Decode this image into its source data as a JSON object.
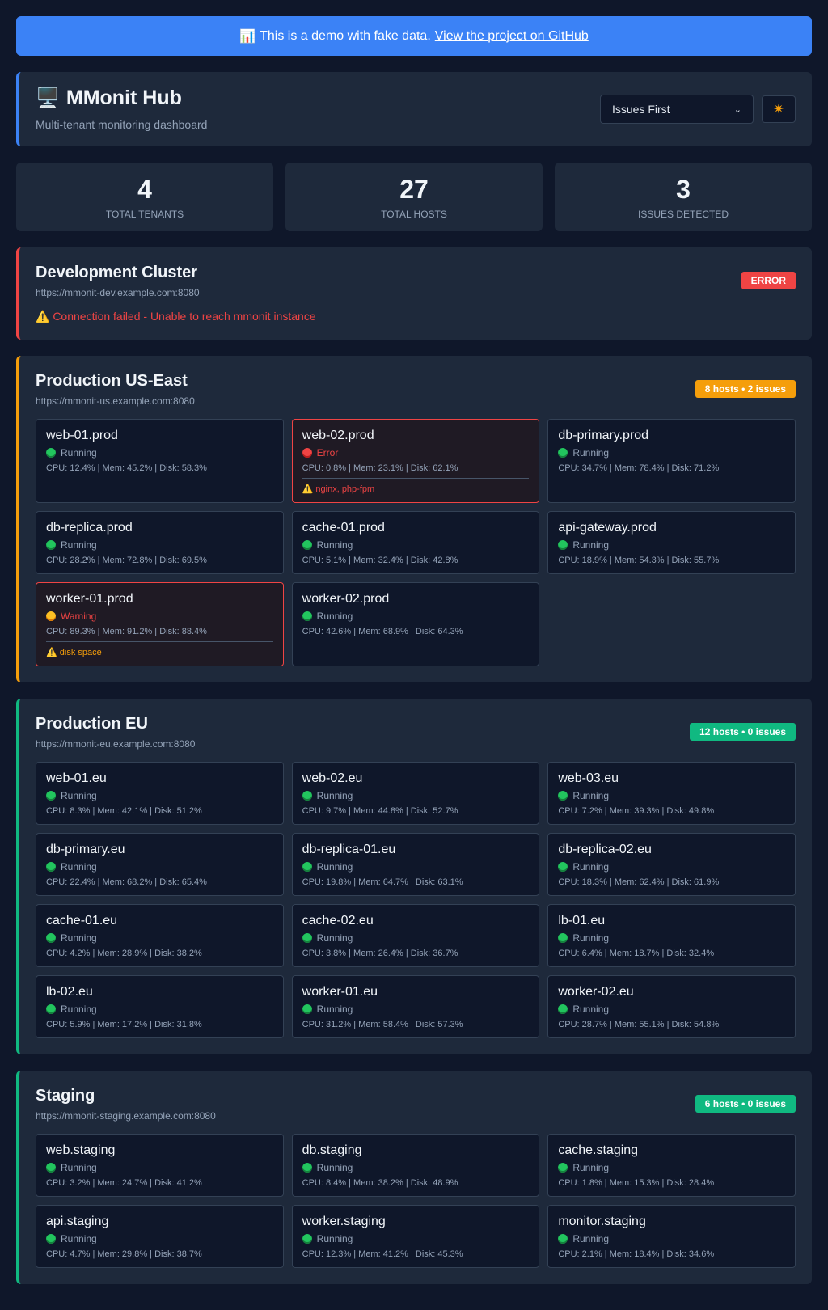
{
  "banner": {
    "icon": "📊",
    "text": "This is a demo with fake data.",
    "link": "View the project on GitHub"
  },
  "header": {
    "icon": "🖥️",
    "title": "MMonit Hub",
    "subtitle": "Multi-tenant monitoring dashboard",
    "sort_value": "Issues First",
    "theme_icon": "✷"
  },
  "stats": [
    {
      "value": "4",
      "label": "Total Tenants"
    },
    {
      "value": "27",
      "label": "Total Hosts"
    },
    {
      "value": "3",
      "label": "Issues Detected"
    }
  ],
  "colors": {
    "accent": "#3b82f6",
    "ok": "#10b981",
    "warn": "#f59e0b",
    "error": "#ef4444"
  },
  "tenants": [
    {
      "name": "Development Cluster",
      "url": "https://mmonit-dev.example.com:8080",
      "badge": "ERROR",
      "state": "err",
      "error": "⚠️ Connection failed - Unable to reach mmonit instance",
      "hosts": []
    },
    {
      "name": "Production US-East",
      "url": "https://mmonit-us.example.com:8080",
      "badge": "8 hosts • 2 issues",
      "state": "warn",
      "error": "",
      "hosts": [
        {
          "name": "web-01.prod",
          "status": "Running",
          "metrics": "CPU: 12.4% | Mem: 45.2% | Disk: 58.3%",
          "issues": ""
        },
        {
          "name": "web-02.prod",
          "status": "Error",
          "metrics": "CPU: 0.8% | Mem: 23.1% | Disk: 62.1%",
          "issues": "⚠️ nginx, php-fpm"
        },
        {
          "name": "db-primary.prod",
          "status": "Running",
          "metrics": "CPU: 34.7% | Mem: 78.4% | Disk: 71.2%",
          "issues": ""
        },
        {
          "name": "db-replica.prod",
          "status": "Running",
          "metrics": "CPU: 28.2% | Mem: 72.8% | Disk: 69.5%",
          "issues": ""
        },
        {
          "name": "cache-01.prod",
          "status": "Running",
          "metrics": "CPU: 5.1% | Mem: 32.4% | Disk: 42.8%",
          "issues": ""
        },
        {
          "name": "api-gateway.prod",
          "status": "Running",
          "metrics": "CPU: 18.9% | Mem: 54.3% | Disk: 55.7%",
          "issues": ""
        },
        {
          "name": "worker-01.prod",
          "status": "Warning",
          "metrics": "CPU: 89.3% | Mem: 91.2% | Disk: 88.4%",
          "issues": "⚠️ disk space"
        },
        {
          "name": "worker-02.prod",
          "status": "Running",
          "metrics": "CPU: 42.6% | Mem: 68.9% | Disk: 64.3%",
          "issues": ""
        }
      ]
    },
    {
      "name": "Production EU",
      "url": "https://mmonit-eu.example.com:8080",
      "badge": "12 hosts • 0 issues",
      "state": "ok",
      "error": "",
      "hosts": [
        {
          "name": "web-01.eu",
          "status": "Running",
          "metrics": "CPU: 8.3% | Mem: 42.1% | Disk: 51.2%",
          "issues": ""
        },
        {
          "name": "web-02.eu",
          "status": "Running",
          "metrics": "CPU: 9.7% | Mem: 44.8% | Disk: 52.7%",
          "issues": ""
        },
        {
          "name": "web-03.eu",
          "status": "Running",
          "metrics": "CPU: 7.2% | Mem: 39.3% | Disk: 49.8%",
          "issues": ""
        },
        {
          "name": "db-primary.eu",
          "status": "Running",
          "metrics": "CPU: 22.4% | Mem: 68.2% | Disk: 65.4%",
          "issues": ""
        },
        {
          "name": "db-replica-01.eu",
          "status": "Running",
          "metrics": "CPU: 19.8% | Mem: 64.7% | Disk: 63.1%",
          "issues": ""
        },
        {
          "name": "db-replica-02.eu",
          "status": "Running",
          "metrics": "CPU: 18.3% | Mem: 62.4% | Disk: 61.9%",
          "issues": ""
        },
        {
          "name": "cache-01.eu",
          "status": "Running",
          "metrics": "CPU: 4.2% | Mem: 28.9% | Disk: 38.2%",
          "issues": ""
        },
        {
          "name": "cache-02.eu",
          "status": "Running",
          "metrics": "CPU: 3.8% | Mem: 26.4% | Disk: 36.7%",
          "issues": ""
        },
        {
          "name": "lb-01.eu",
          "status": "Running",
          "metrics": "CPU: 6.4% | Mem: 18.7% | Disk: 32.4%",
          "issues": ""
        },
        {
          "name": "lb-02.eu",
          "status": "Running",
          "metrics": "CPU: 5.9% | Mem: 17.2% | Disk: 31.8%",
          "issues": ""
        },
        {
          "name": "worker-01.eu",
          "status": "Running",
          "metrics": "CPU: 31.2% | Mem: 58.4% | Disk: 57.3%",
          "issues": ""
        },
        {
          "name": "worker-02.eu",
          "status": "Running",
          "metrics": "CPU: 28.7% | Mem: 55.1% | Disk: 54.8%",
          "issues": ""
        }
      ]
    },
    {
      "name": "Staging",
      "url": "https://mmonit-staging.example.com:8080",
      "badge": "6 hosts • 0 issues",
      "state": "ok",
      "error": "",
      "hosts": [
        {
          "name": "web.staging",
          "status": "Running",
          "metrics": "CPU: 3.2% | Mem: 24.7% | Disk: 41.2%",
          "issues": ""
        },
        {
          "name": "db.staging",
          "status": "Running",
          "metrics": "CPU: 8.4% | Mem: 38.2% | Disk: 48.9%",
          "issues": ""
        },
        {
          "name": "cache.staging",
          "status": "Running",
          "metrics": "CPU: 1.8% | Mem: 15.3% | Disk: 28.4%",
          "issues": ""
        },
        {
          "name": "api.staging",
          "status": "Running",
          "metrics": "CPU: 4.7% | Mem: 29.8% | Disk: 38.7%",
          "issues": ""
        },
        {
          "name": "worker.staging",
          "status": "Running",
          "metrics": "CPU: 12.3% | Mem: 41.2% | Disk: 45.3%",
          "issues": ""
        },
        {
          "name": "monitor.staging",
          "status": "Running",
          "metrics": "CPU: 2.1% | Mem: 18.4% | Disk: 34.6%",
          "issues": ""
        }
      ]
    }
  ]
}
